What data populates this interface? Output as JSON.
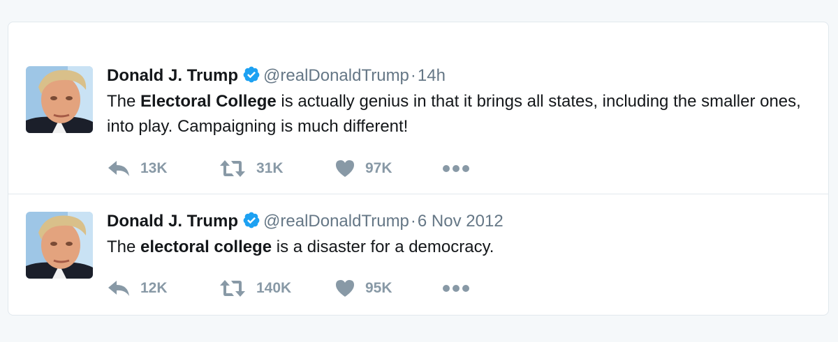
{
  "tweets": [
    {
      "name": "Donald J. Trump",
      "handle": "@realDonaldTrump",
      "separator": "·",
      "time": "14h",
      "text_parts": [
        {
          "text": "The ",
          "bold": false
        },
        {
          "text": "Electoral College",
          "bold": true
        },
        {
          "text": " is actually genius in that it brings all states, including the smaller ones, into play. Campaigning is much different!",
          "bold": false
        }
      ],
      "replies": "13K",
      "retweets": "31K",
      "likes": "97K"
    },
    {
      "name": "Donald J. Trump",
      "handle": "@realDonaldTrump",
      "separator": "·",
      "time": "6 Nov 2012",
      "text_parts": [
        {
          "text": "The ",
          "bold": false
        },
        {
          "text": "electoral college",
          "bold": true
        },
        {
          "text": " is a disaster for a democracy.",
          "bold": false
        }
      ],
      "replies": "12K",
      "retweets": "140K",
      "likes": "95K"
    }
  ],
  "icons": {
    "reply": "reply-icon",
    "retweet": "retweet-icon",
    "like": "heart-icon",
    "more": "more-dots-icon",
    "verified": "verified-badge-icon"
  },
  "colors": {
    "verified": "#1da1f2",
    "action_gray": "#8899a6",
    "handle_gray": "#657786",
    "border": "#e1e8ed",
    "background": "#f5f8fa"
  }
}
